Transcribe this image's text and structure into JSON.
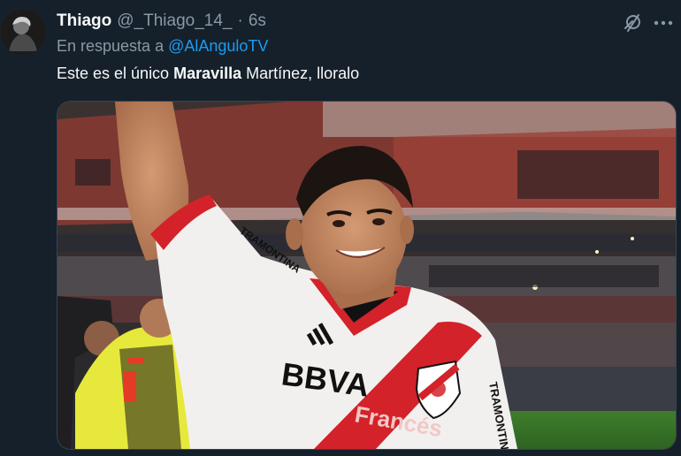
{
  "tweet": {
    "author_name": "Thiago",
    "author_handle": "@_Thiago_14_",
    "separator": "·",
    "time": "6s",
    "reply_prefix": "En respuesta a",
    "reply_to": "@AlAnguloTV",
    "text_before": "Este es el único ",
    "text_bold": "Maravilla",
    "text_after": " Martínez, lloralo"
  },
  "image": {
    "jersey_sponsor": "BBVA",
    "jersey_sponsor_sub": "Francés",
    "jersey_brand_right": "TRAMONTINA",
    "sleeve_text": "TRAMONTINA"
  },
  "icons": {
    "grok": "grok-icon",
    "more": "more-icon"
  },
  "colors": {
    "background": "#15202b",
    "link": "#1d9bf0",
    "muted": "#8b98a5",
    "jersey_red": "#d3222a"
  }
}
